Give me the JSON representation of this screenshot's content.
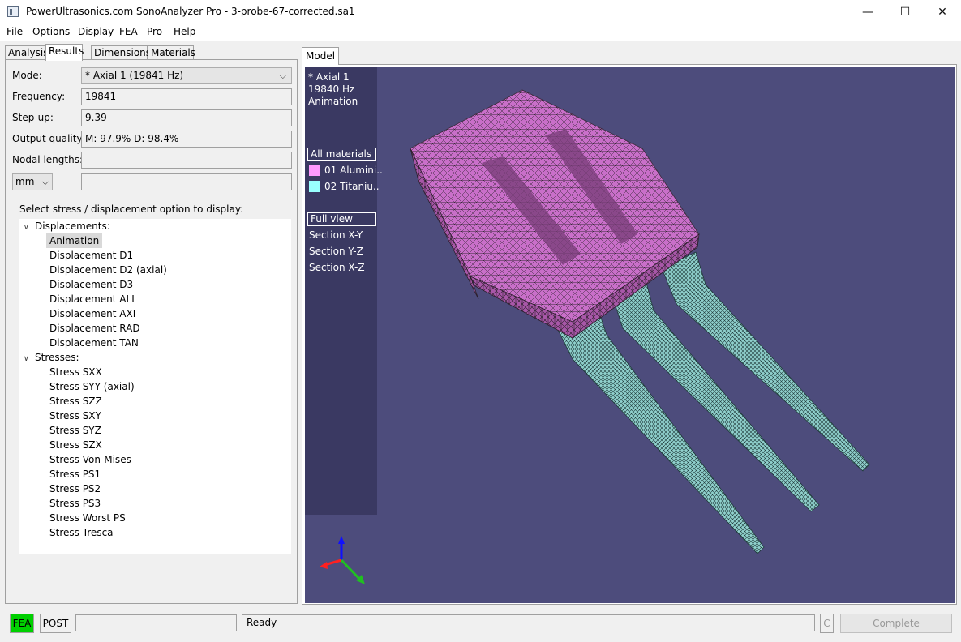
{
  "window": {
    "title": "PowerUltrasonics.com SonoAnalyzer Pro - 3-probe-67-corrected.sa1",
    "minimize": "—",
    "maximize": "☐",
    "close": "✕"
  },
  "menu": [
    "File",
    "Options",
    "Display",
    "FEA",
    "Pro",
    "Help"
  ],
  "left_tabs": [
    "Analysis",
    "Results",
    "Dimensions",
    "Materials"
  ],
  "active_left_tab": "Results",
  "fields": {
    "mode_label": "Mode:",
    "mode_value": "* Axial 1 (19841 Hz)",
    "frequency_label": "Frequency:",
    "frequency_value": "19841",
    "stepup_label": "Step-up:",
    "stepup_value": "9.39",
    "quality_label": "Output quality:",
    "quality_value": "M: 97.9% D: 98.4%",
    "nodal_label": "Nodal lengths:",
    "nodal_value": "",
    "unit_value": "mm",
    "unit_extra_value": ""
  },
  "select_label": "Select stress / displacement option to display:",
  "tree": {
    "displacements_label": "Displacements:",
    "displacements": [
      "Animation",
      "Displacement D1",
      "Displacement D2 (axial)",
      "Displacement D3",
      "Displacement ALL",
      "Displacement AXI",
      "Displacement RAD",
      "Displacement TAN"
    ],
    "stresses_label": "Stresses:",
    "stresses": [
      "Stress SXX",
      "Stress SYY (axial)",
      "Stress SZZ",
      "Stress SXY",
      "Stress SYZ",
      "Stress SZX",
      "Stress Von-Mises",
      "Stress PS1",
      "Stress PS2",
      "Stress PS3",
      "Stress Worst PS",
      "Stress Tresca"
    ],
    "selected": "Animation"
  },
  "model_tab": "Model",
  "viewport": {
    "mode_name": "* Axial 1",
    "frequency": "19840 Hz",
    "display": "Animation",
    "materials_header": "All materials",
    "materials": [
      {
        "label": "01 Alumini..",
        "color": "#ff99ff"
      },
      {
        "label": "02 Titaniu..",
        "color": "#99ffff"
      }
    ],
    "views": [
      "Full view",
      "Section X-Y",
      "Section Y-Z",
      "Section X-Z"
    ],
    "background": "#4d4c7c",
    "side_background": "#3a3962"
  },
  "status": {
    "fea": "FEA",
    "post": "POST",
    "message": "Ready",
    "c": "C",
    "complete": "Complete",
    "fea_color": "#00d000"
  }
}
